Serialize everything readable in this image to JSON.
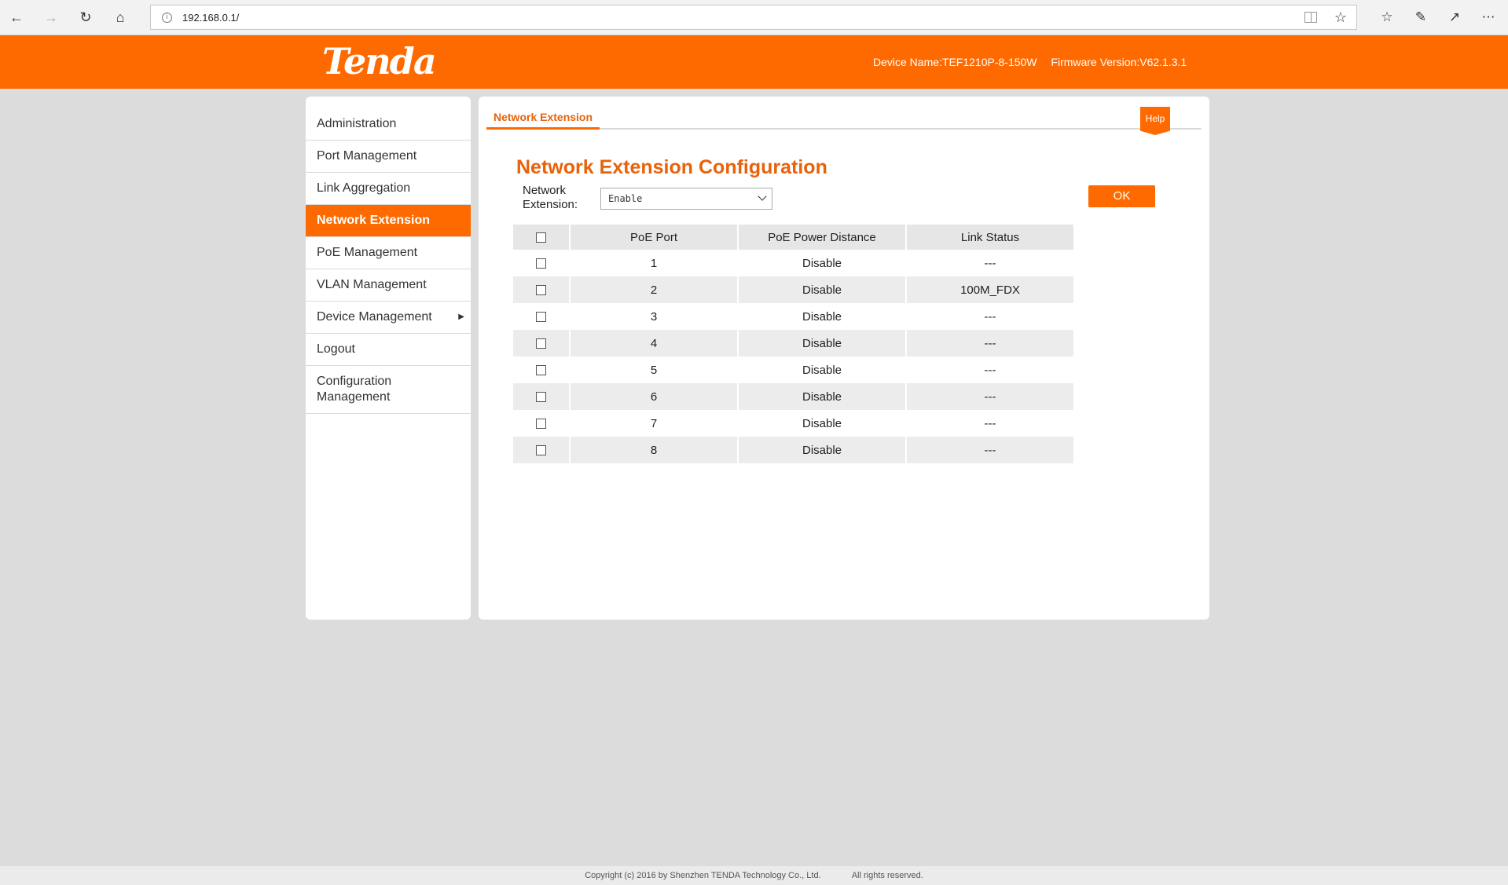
{
  "browser": {
    "url": "192.168.0.1/"
  },
  "header": {
    "logo": "Tenda",
    "device_name": "Device Name:TEF1210P-8-150W",
    "firmware_version": "Firmware Version:V62.1.3.1"
  },
  "sidebar": {
    "items": [
      {
        "label": "Administration"
      },
      {
        "label": "Port Management"
      },
      {
        "label": "Link Aggregation"
      },
      {
        "label": "Network Extension",
        "active": true
      },
      {
        "label": "PoE Management"
      },
      {
        "label": "VLAN Management"
      },
      {
        "label": "Device Management",
        "has_submenu": true
      },
      {
        "label": "Logout"
      },
      {
        "label": "Configuration Management"
      }
    ]
  },
  "main": {
    "tab": "Network Extension",
    "help": "Help",
    "title": "Network Extension Configuration",
    "network_extension_label": "Network Extension:",
    "network_extension_value": "Enable",
    "ok_label": "OK",
    "table": {
      "headers": [
        "PoE Port",
        "PoE Power Distance",
        "Link Status"
      ],
      "rows": [
        {
          "port": "1",
          "distance": "Disable",
          "status": "---"
        },
        {
          "port": "2",
          "distance": "Disable",
          "status": "100M_FDX"
        },
        {
          "port": "3",
          "distance": "Disable",
          "status": "---"
        },
        {
          "port": "4",
          "distance": "Disable",
          "status": "---"
        },
        {
          "port": "5",
          "distance": "Disable",
          "status": "---"
        },
        {
          "port": "6",
          "distance": "Disable",
          "status": "---"
        },
        {
          "port": "7",
          "distance": "Disable",
          "status": "---"
        },
        {
          "port": "8",
          "distance": "Disable",
          "status": "---"
        }
      ]
    }
  },
  "footer": {
    "copyright": "Copyright (c) 2016 by Shenzhen TENDA Technology Co., Ltd.",
    "rights": "All rights reserved."
  },
  "colors": {
    "brand": "#ff6a00",
    "title": "#e8620a"
  }
}
